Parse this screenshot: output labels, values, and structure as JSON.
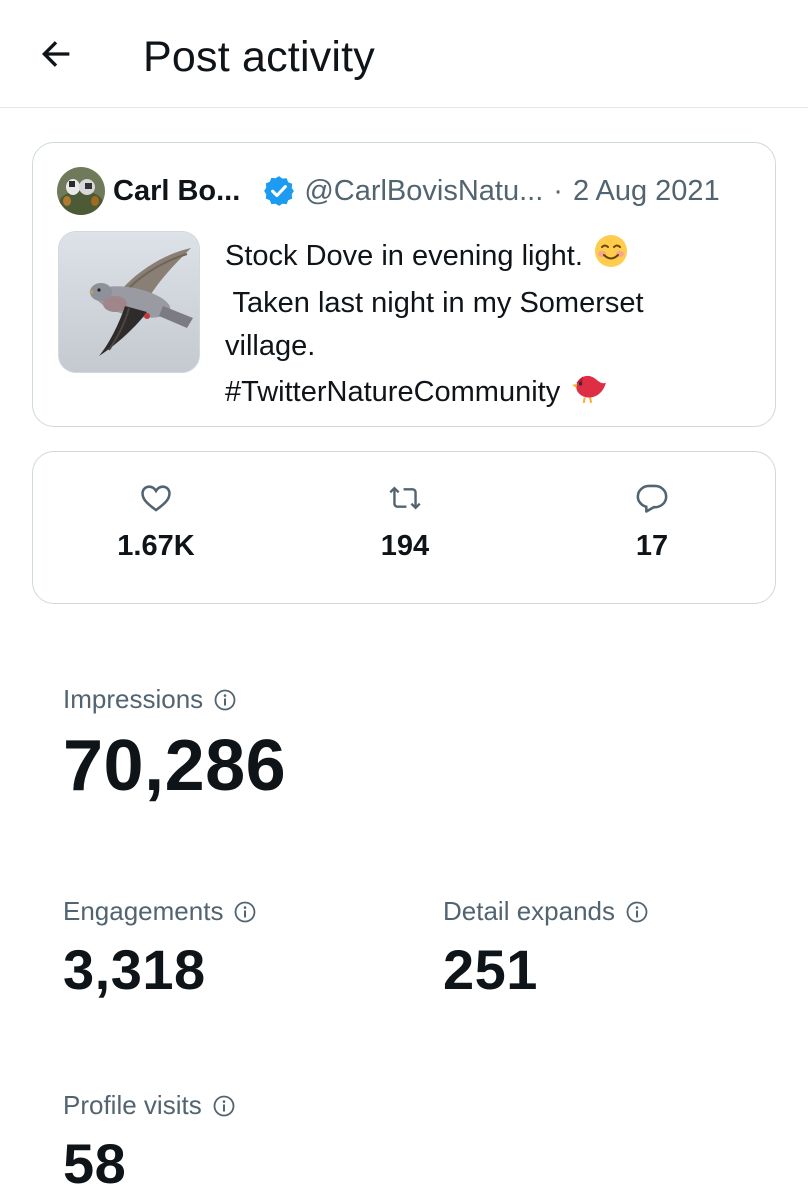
{
  "header": {
    "title": "Post activity",
    "back_icon": "arrow-left-icon"
  },
  "post": {
    "author_name": "Carl Bo...",
    "verified_icon": "verified-badge-icon",
    "handle": "@CarlBovisNatu...",
    "separator": "·",
    "date": "2 Aug 2021",
    "text_lines": [
      "Stock Dove in evening light.",
      " Taken last night in my Somerset",
      "village.",
      "#TwitterNatureCommunity"
    ],
    "emoji_1": "smiling-face-emoji",
    "emoji_2": "red-bird-emoji",
    "image": "stock-dove-photo"
  },
  "stats": {
    "likes": {
      "icon": "heart-icon",
      "value": "1.67K"
    },
    "retweets": {
      "icon": "retweet-icon",
      "value": "194"
    },
    "replies": {
      "icon": "reply-icon",
      "value": "17"
    }
  },
  "metrics": {
    "impressions": {
      "label": "Impressions",
      "value": "70,286"
    },
    "engagements": {
      "label": "Engagements",
      "value": "3,318"
    },
    "detail_expands": {
      "label": "Detail expands",
      "value": "251"
    },
    "profile_visits": {
      "label": "Profile visits",
      "value": "58"
    }
  },
  "colors": {
    "text_primary": "#0f1419",
    "text_secondary": "#536471",
    "border": "#cfd9de",
    "verified_blue": "#1d9bf0"
  }
}
